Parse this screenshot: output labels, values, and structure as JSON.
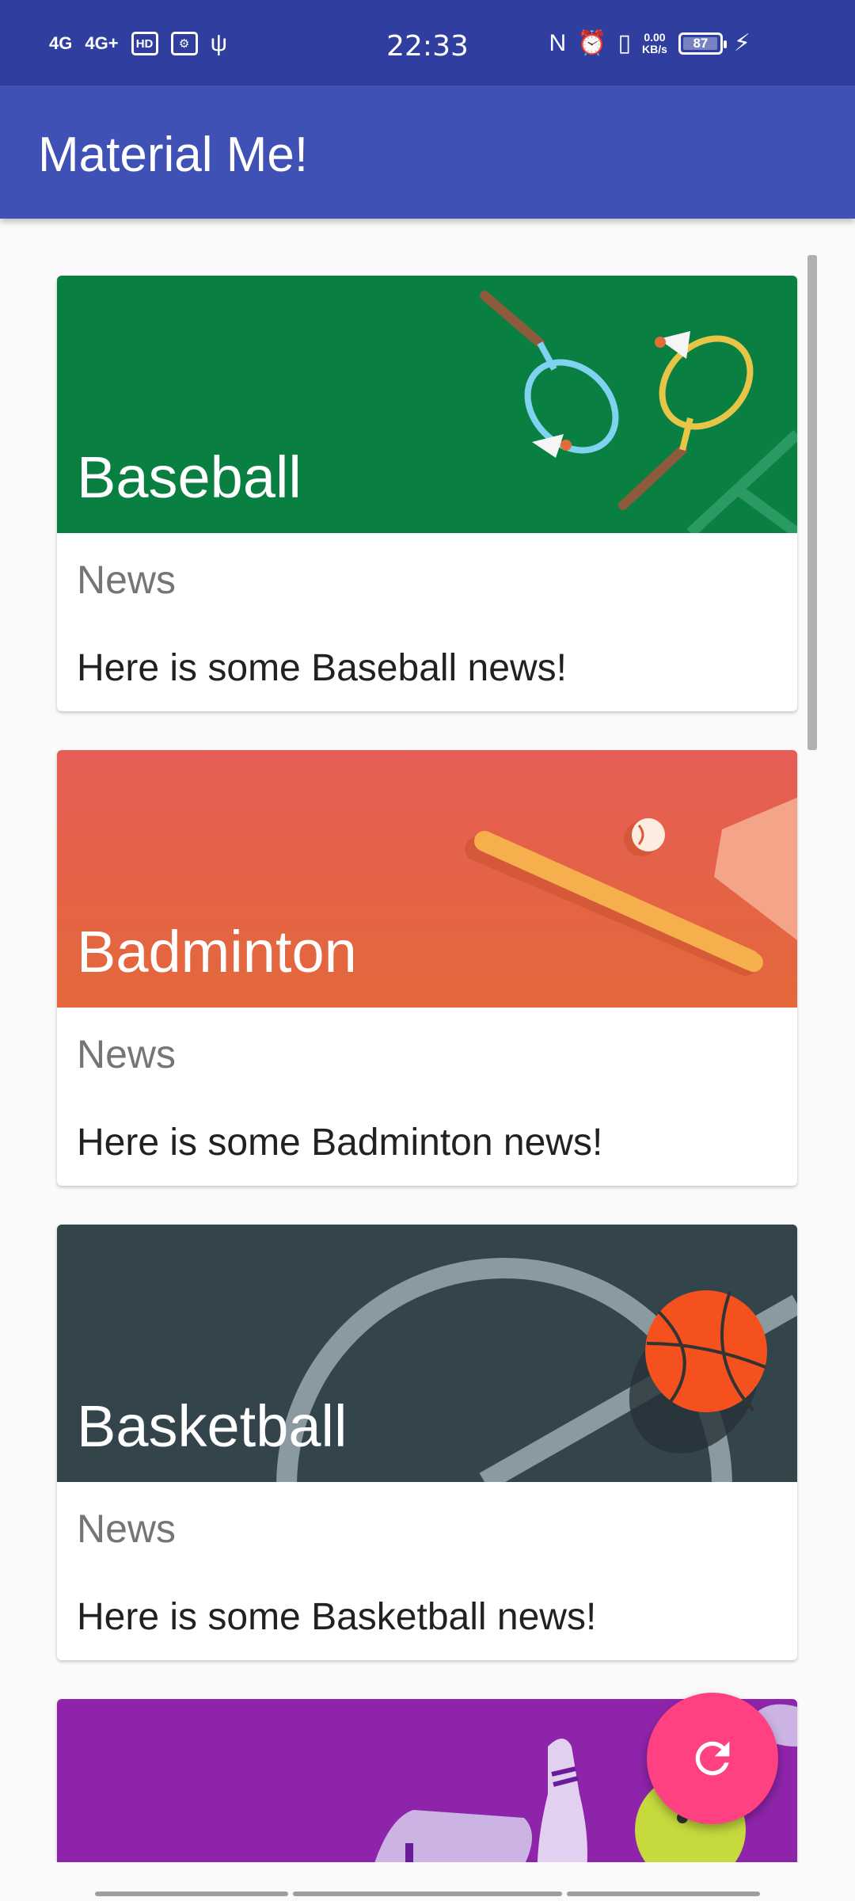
{
  "status_bar": {
    "network_1": "4G",
    "network_2": "4G+",
    "hd_label": "HD",
    "time": "22:33",
    "speed_value": "0.00",
    "speed_unit": "KB/s",
    "battery": "87",
    "battery_level": 0.87
  },
  "app_bar": {
    "title": "Material Me!"
  },
  "cards": [
    {
      "title": "Baseball",
      "subtitle": "News",
      "text": "Here is some Baseball news!",
      "image": "badminton-illustration",
      "color": "#0a7f42"
    },
    {
      "title": "Badminton",
      "subtitle": "News",
      "text": "Here is some Badminton news!",
      "image": "baseball-illustration",
      "color": "#e5603f"
    },
    {
      "title": "Basketball",
      "subtitle": "News",
      "text": "Here is some Basketball news!",
      "image": "basketball-illustration",
      "color": "#34444b"
    },
    {
      "title": "",
      "subtitle": "",
      "text": "",
      "image": "bowling-illustration",
      "color": "#8e24aa"
    }
  ],
  "fab": {
    "icon": "refresh-icon",
    "color": "#ff4081"
  },
  "colors": {
    "status_bar": "#303f9f",
    "app_bar": "#3f51b5",
    "background": "#fafafa"
  }
}
